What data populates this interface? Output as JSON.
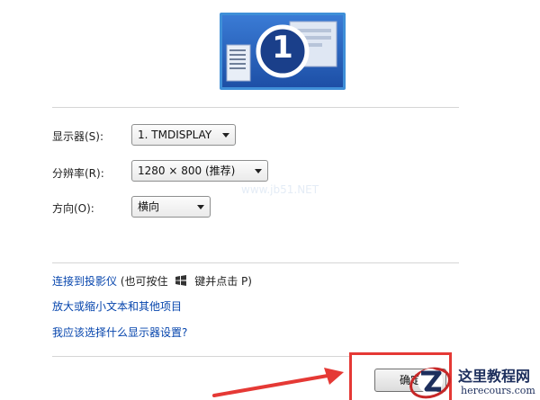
{
  "monitor": {
    "number": "1"
  },
  "fields": {
    "display": {
      "label": "显示器(S):",
      "value": "1. TMDISPLAY"
    },
    "resolution": {
      "label": "分辨率(R):",
      "value": "1280 × 800 (推荐)"
    },
    "orientation": {
      "label": "方向(O):",
      "value": "横向"
    }
  },
  "faint_watermark": "www.jb51.NET",
  "links": {
    "projector": {
      "text": "连接到投影仪",
      "note_prefix": "(也可按住",
      "note_suffix": "键并点击 P)"
    },
    "text_size": "放大或缩小文本和其他项目",
    "which_settings": "我应该选择什么显示器设置?"
  },
  "ok_button": "确定",
  "site": {
    "name": "这里教程网",
    "url": "herecours.com"
  },
  "colors": {
    "link": "#0645ad",
    "highlight": "#e53935",
    "arrow": "#e53935"
  }
}
